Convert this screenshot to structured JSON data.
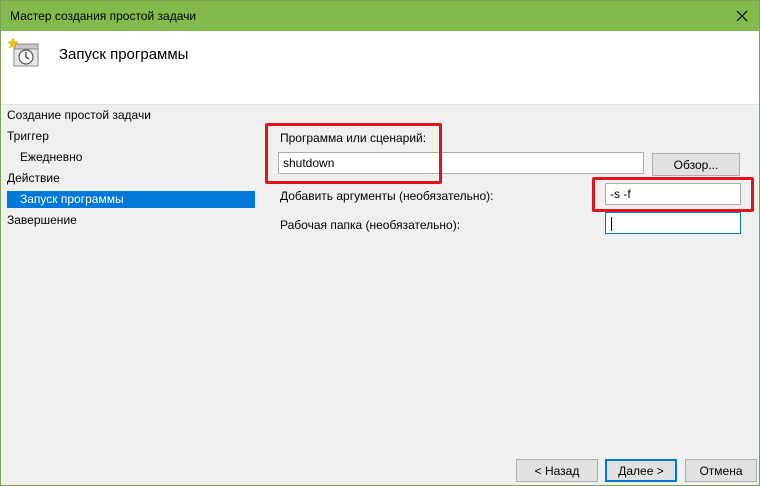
{
  "window": {
    "title": "Мастер создания простой задачи",
    "header_title": "Запуск программы"
  },
  "sidebar": {
    "items": [
      {
        "label": "Создание простой задачи",
        "level": 0,
        "selected": false
      },
      {
        "label": "Триггер",
        "level": 0,
        "selected": false
      },
      {
        "label": "Ежедневно",
        "level": 1,
        "selected": false
      },
      {
        "label": "Действие",
        "level": 0,
        "selected": false
      },
      {
        "label": "Запуск программы",
        "level": 1,
        "selected": true
      },
      {
        "label": "Завершение",
        "level": 0,
        "selected": false
      }
    ]
  },
  "form": {
    "program_label": "Программа или сценарий:",
    "program_value": "shutdown",
    "browse_label": "Обзор...",
    "args_label": "Добавить аргументы (необязательно):",
    "args_value": "-s -f",
    "workdir_label": "Рабочая папка (необязательно):",
    "workdir_value": ""
  },
  "footer": {
    "back_label": "< Назад",
    "next_label": "Далее >",
    "cancel_label": "Отмена"
  },
  "colors": {
    "titlebar": "#84ba4b",
    "selection": "#0078d7",
    "highlight": "#e0141e"
  }
}
